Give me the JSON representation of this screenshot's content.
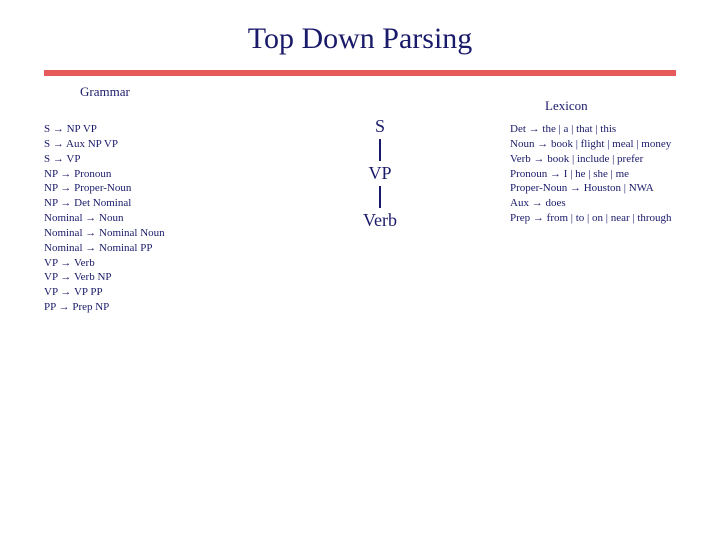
{
  "title": "Top Down Parsing",
  "headers": {
    "grammar": "Grammar",
    "lexicon": "Lexicon"
  },
  "arrow": "→",
  "grammar_rules": [
    {
      "lhs": "S",
      "rhs": "NP VP"
    },
    {
      "lhs": "S",
      "rhs": "Aux NP VP"
    },
    {
      "lhs": "S",
      "rhs": "VP"
    },
    {
      "lhs": "NP",
      "rhs": "Pronoun"
    },
    {
      "lhs": "NP",
      "rhs": "Proper-Noun"
    },
    {
      "lhs": "NP",
      "rhs": "Det Nominal"
    },
    {
      "lhs": "Nominal",
      "rhs": "Noun"
    },
    {
      "lhs": "Nominal",
      "rhs": "Nominal Noun"
    },
    {
      "lhs": "Nominal",
      "rhs": "Nominal PP"
    },
    {
      "lhs": "VP",
      "rhs": "Verb"
    },
    {
      "lhs": "VP",
      "rhs": "Verb NP"
    },
    {
      "lhs": "VP",
      "rhs": "VP PP"
    },
    {
      "lhs": "PP",
      "rhs": "Prep NP"
    }
  ],
  "lexicon_rules": [
    {
      "lhs": "Det",
      "rhs": "the | a | that | this"
    },
    {
      "lhs": "Noun",
      "rhs": "book | flight | meal | money"
    },
    {
      "lhs": "Verb",
      "rhs": "book | include | prefer"
    },
    {
      "lhs": "Pronoun",
      "rhs": "I | he | she | me"
    },
    {
      "lhs": "Proper-Noun",
      "rhs": "Houston | NWA"
    },
    {
      "lhs": "Aux",
      "rhs": "does"
    },
    {
      "lhs": "Prep",
      "rhs": "from | to | on | near | through"
    }
  ],
  "tree": {
    "n0": "S",
    "n1": "VP",
    "n2": "Verb"
  }
}
